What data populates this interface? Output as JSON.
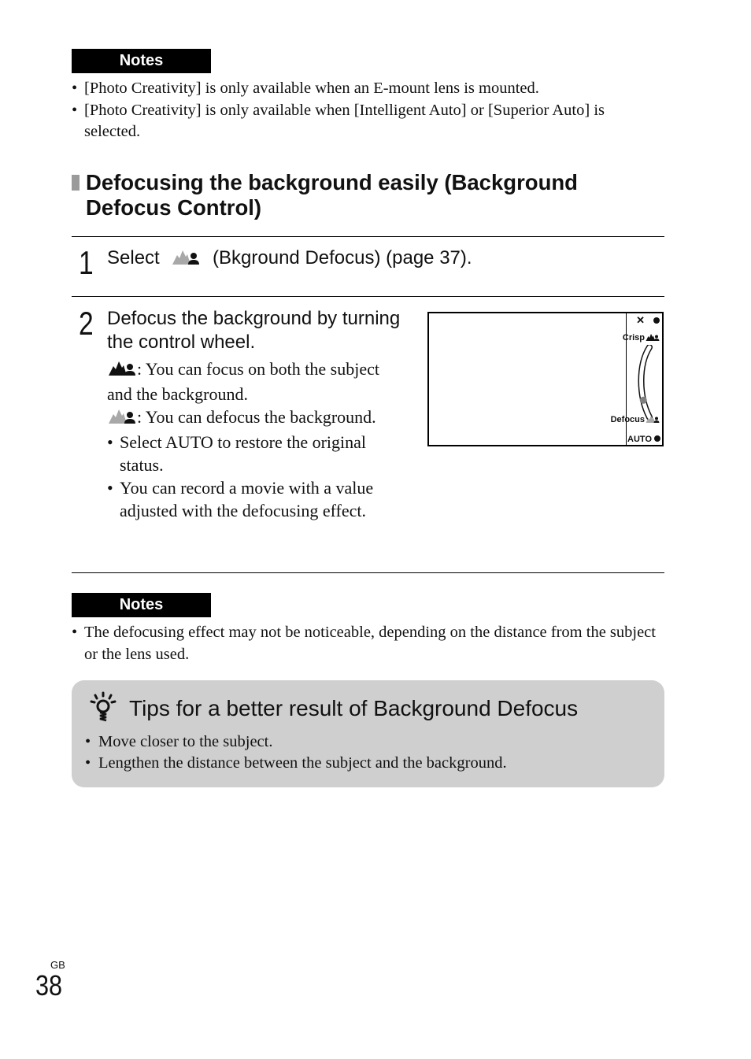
{
  "notes_top": {
    "label": "Notes",
    "items": [
      "[Photo Creativity] is only available when an E-mount lens is mounted.",
      "[Photo Creativity] is only available when [Intelligent Auto] or [Superior Auto] is selected."
    ]
  },
  "section": {
    "title": "Defocusing the background easily (Background Defocus Control)"
  },
  "step1": {
    "number": "1",
    "text_before": "Select",
    "icon": "background-defocus-icon",
    "text_after": "(Bkground Defocus) (page 37)."
  },
  "step2": {
    "number": "2",
    "title": "Defocus the background by turning the control wheel.",
    "crisp_desc": ": You can focus on both the subject and the background.",
    "defocus_desc": ": You can defocus the background.",
    "bullets": [
      "Select AUTO to restore the original status.",
      "You can record a movie with a value adjusted with the defocusing effect."
    ]
  },
  "screen": {
    "close_label": "✕",
    "crisp_label": "Crisp",
    "defocus_label": "Defocus",
    "auto_label": "AUTO",
    "slider_level": 0.25
  },
  "notes_bottom": {
    "label": "Notes",
    "items": [
      "The defocusing effect may not be noticeable, depending on the distance from the subject or the lens used."
    ]
  },
  "tips": {
    "icon": "lightbulb-icon",
    "title": "Tips for a better result of Background Defocus",
    "items": [
      "Move closer to the subject.",
      "Lengthen the distance between the subject and the background."
    ]
  },
  "footer": {
    "region": "GB",
    "page": "38"
  }
}
